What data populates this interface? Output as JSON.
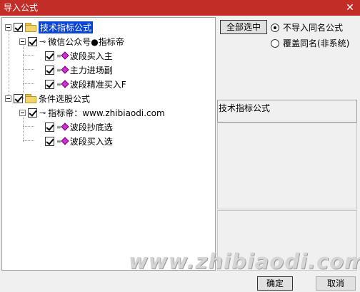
{
  "window": {
    "title": "导入公式",
    "close_icon": "close-icon"
  },
  "tree": {
    "groups": [
      {
        "label": "技术指标公式",
        "checked": true,
        "selected": true,
        "children": [
          {
            "label": "微信公众号●指标帝",
            "checked": true,
            "children": [
              {
                "label": "波段买入主",
                "checked": true
              },
              {
                "label": "主力进场副",
                "checked": true
              },
              {
                "label": "波段精准买入F",
                "checked": true
              }
            ]
          }
        ]
      },
      {
        "label": "条件选股公式",
        "checked": true,
        "selected": false,
        "children": [
          {
            "label": "指标帝：www.zhibiaodi.com",
            "checked": true,
            "children": [
              {
                "label": "波段抄底选",
                "checked": true
              },
              {
                "label": "波段买入选",
                "checked": true
              }
            ]
          }
        ]
      }
    ]
  },
  "options": {
    "select_all_label": "全部选中",
    "radio": [
      {
        "label": "不导入同名公式",
        "checked": true
      },
      {
        "label": "覆盖同名(非系统)",
        "checked": false
      }
    ]
  },
  "info_panel": {
    "title": "技术指标公式"
  },
  "watermark": "www.zhibiaodi.com",
  "footer": {
    "ok_label": "确定",
    "cancel_label": "取消"
  }
}
